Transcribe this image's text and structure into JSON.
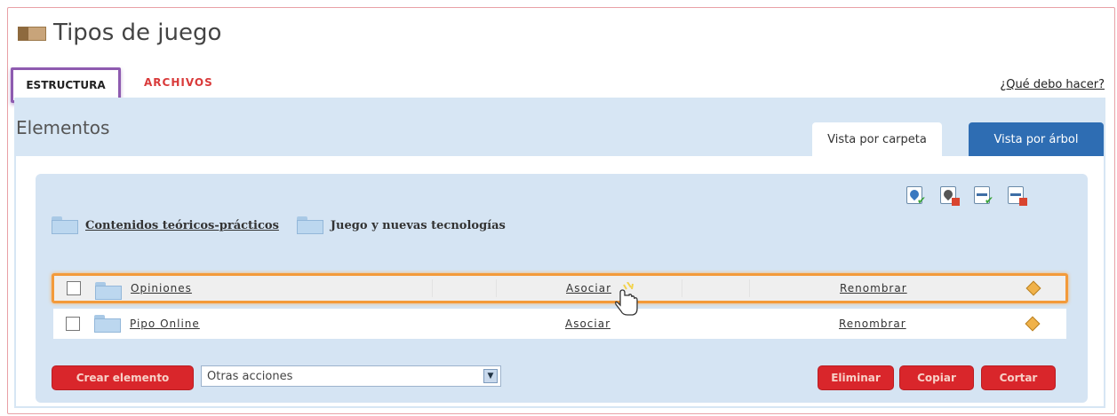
{
  "page": {
    "title": "Tipos de juego",
    "title_icon": "box-icon"
  },
  "tabs": {
    "estructura": "ESTRUCTURA",
    "archivos": "ARCHIVOS"
  },
  "help_link": "¿Qué debo hacer?",
  "section_title": "Elementos",
  "view_tabs": {
    "carpeta": "Vista por carpeta",
    "arbol": "Vista por árbol"
  },
  "toolbar_icons": [
    "permissions-grant-icon",
    "permissions-remove-icon",
    "check-minus-icon",
    "delete-minus-icon"
  ],
  "breadcrumb_folders": [
    {
      "label": "Contenidos teóricos-prácticos",
      "link": true
    },
    {
      "label": "Juego y nuevas tecnologías",
      "link": false
    }
  ],
  "rows": [
    {
      "name": "Opiniones",
      "associate": "Asociar",
      "rename": "Renombrar",
      "highlighted": true
    },
    {
      "name": "Pipo Online",
      "associate": "Asociar",
      "rename": "Renombrar",
      "highlighted": false
    }
  ],
  "actions": {
    "create": "Crear elemento",
    "other_actions": "Otras acciones",
    "delete": "Eliminar",
    "copy": "Copiar",
    "cut": "Cortar"
  },
  "colors": {
    "accent_red": "#d9262b",
    "highlight_orange": "#f39a3a",
    "active_tab_border": "#8e5bb0",
    "tree_tab_blue": "#2e6db3"
  }
}
